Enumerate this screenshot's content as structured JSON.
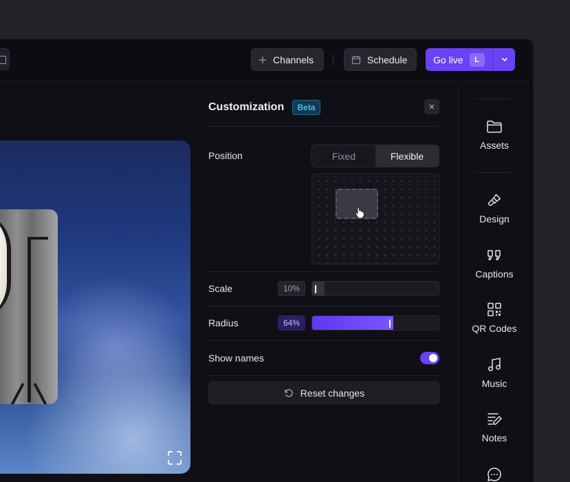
{
  "topbar": {
    "channels_label": "Channels",
    "schedule_label": "Schedule",
    "golive_label": "Go live",
    "golive_key": "L"
  },
  "customization": {
    "title": "Customization",
    "badge": "Beta",
    "position": {
      "label": "Position",
      "options": [
        "Fixed",
        "Flexible"
      ],
      "selected": "Flexible"
    },
    "scale": {
      "label": "Scale",
      "value": "10%",
      "percent": 10
    },
    "radius": {
      "label": "Radius",
      "value": "64%",
      "percent": 64
    },
    "show_names": {
      "label": "Show names",
      "enabled": true
    },
    "reset_label": "Reset changes"
  },
  "sidebar": {
    "items": [
      {
        "label": "Assets",
        "icon": "folder-icon"
      },
      {
        "label": "Design",
        "icon": "brush-icon"
      },
      {
        "label": "Captions",
        "icon": "quote-icon"
      },
      {
        "label": "QR Codes",
        "icon": "qr-code-icon"
      },
      {
        "label": "Music",
        "icon": "music-note-icon"
      },
      {
        "label": "Notes",
        "icon": "notes-icon"
      },
      {
        "label": "",
        "icon": "chat-bubble-icon"
      }
    ]
  },
  "colors": {
    "accent": "#6a42f5",
    "background": "#0f0f15",
    "beta_badge": "#4fb8ee"
  }
}
